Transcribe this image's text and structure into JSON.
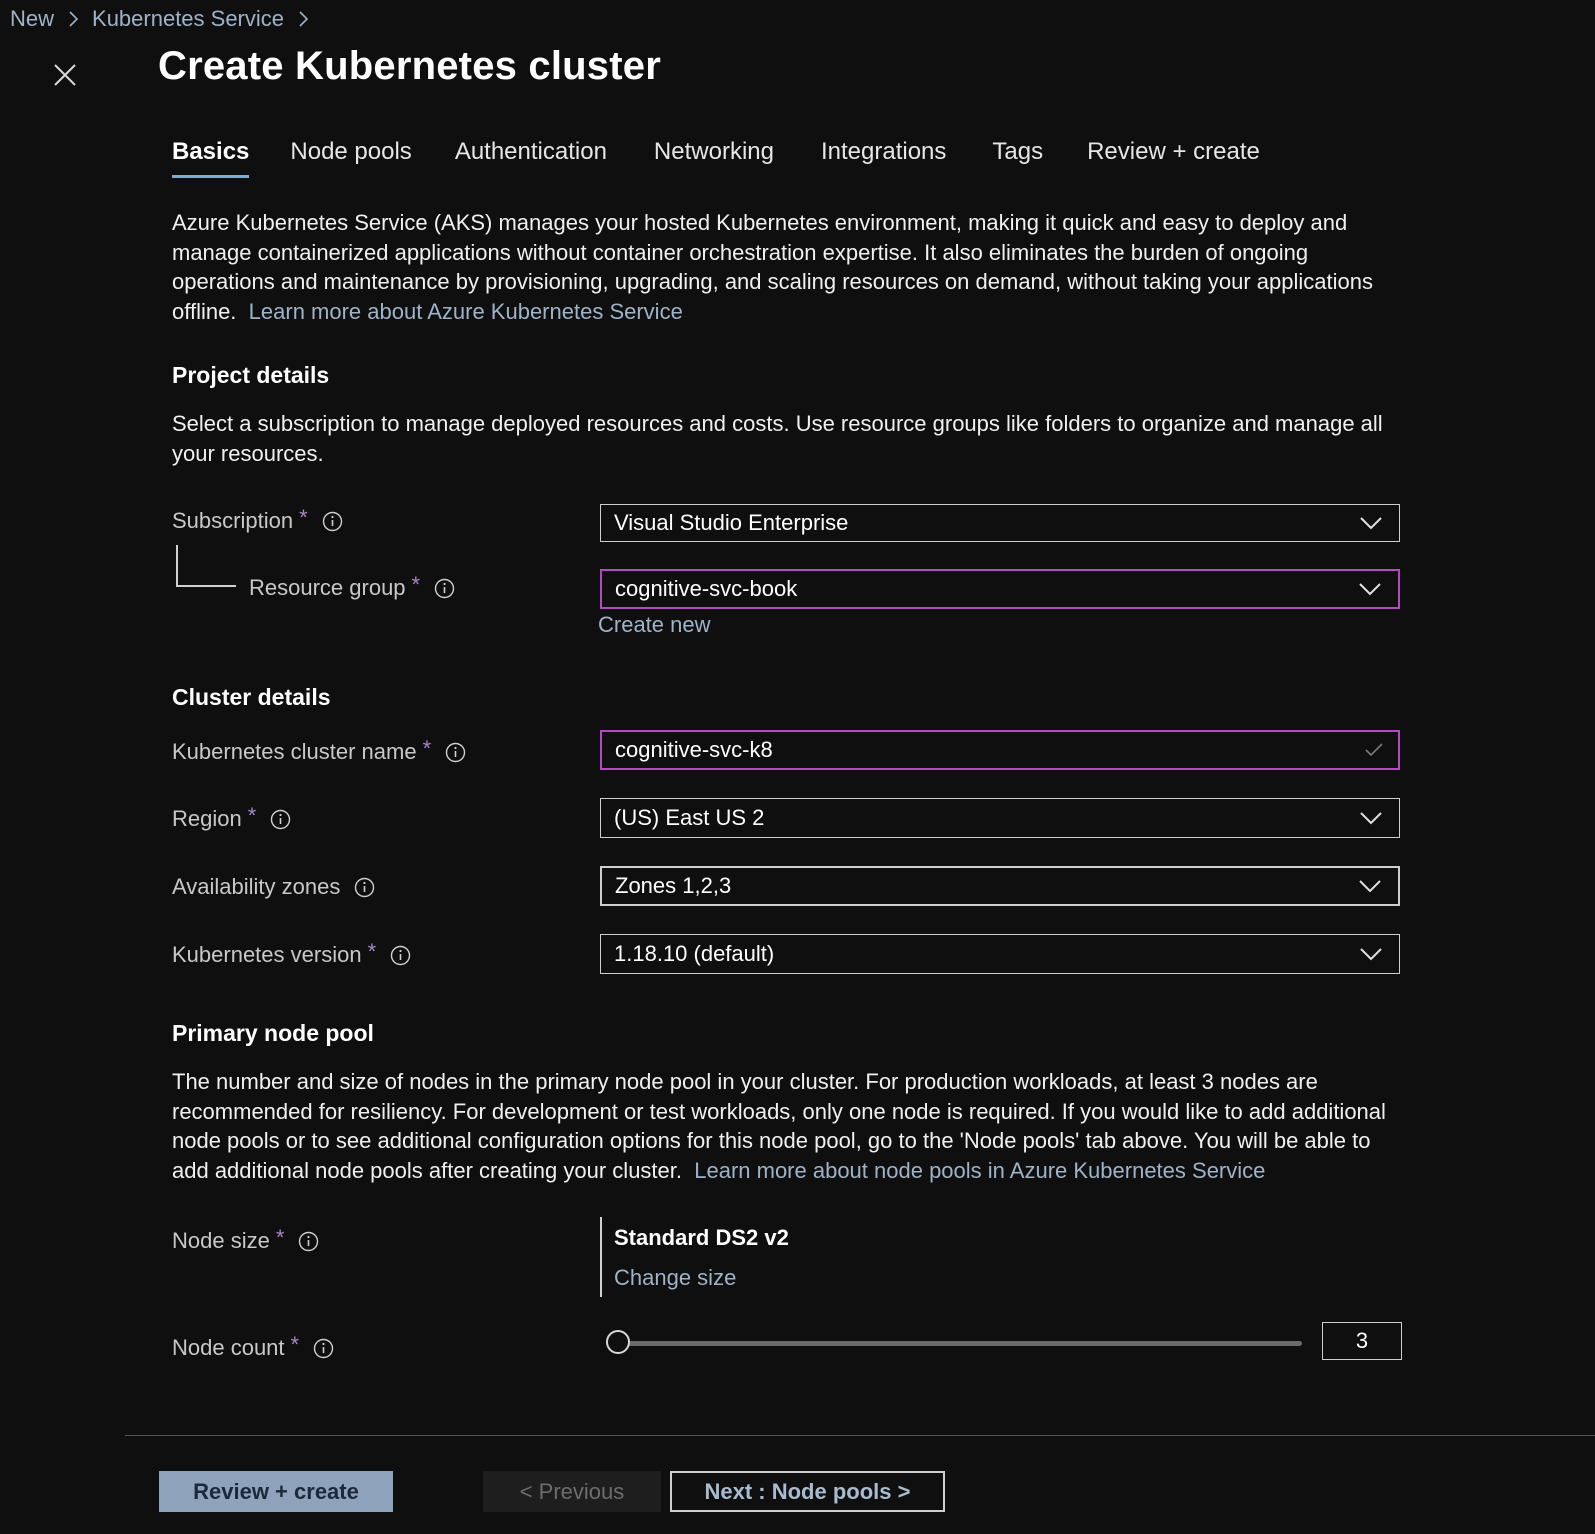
{
  "breadcrumb": {
    "items": [
      "New",
      "Kubernetes Service"
    ]
  },
  "page": {
    "title": "Create Kubernetes cluster"
  },
  "tabs": [
    {
      "label": "Basics",
      "active": true
    },
    {
      "label": "Node pools",
      "active": false
    },
    {
      "label": "Authentication",
      "active": false
    },
    {
      "label": "Networking",
      "active": false
    },
    {
      "label": "Integrations",
      "active": false
    },
    {
      "label": "Tags",
      "active": false
    },
    {
      "label": "Review + create",
      "active": false
    }
  ],
  "intro": {
    "text": "Azure Kubernetes Service (AKS) manages your hosted Kubernetes environment, making it quick and easy to deploy and manage containerized applications without container orchestration expertise. It also eliminates the burden of ongoing operations and maintenance by provisioning, upgrading, and scaling resources on demand, without taking your applications offline.",
    "link": "Learn more about Azure Kubernetes Service"
  },
  "project": {
    "title": "Project details",
    "description": "Select a subscription to manage deployed resources and costs. Use resource groups like folders to organize and manage all your resources.",
    "subscription": {
      "label": "Subscription",
      "required": "*",
      "value": "Visual Studio Enterprise"
    },
    "resource_group": {
      "label": "Resource group",
      "required": "*",
      "value": "cognitive-svc-book",
      "create_new": "Create new"
    }
  },
  "cluster": {
    "title": "Cluster details",
    "name": {
      "label": "Kubernetes cluster name",
      "required": "*",
      "value": "cognitive-svc-k8"
    },
    "region": {
      "label": "Region",
      "required": "*",
      "value": "(US) East US 2"
    },
    "zones": {
      "label": "Availability zones",
      "value": "Zones 1,2,3"
    },
    "version": {
      "label": "Kubernetes version",
      "required": "*",
      "value": "1.18.10 (default)"
    }
  },
  "node_pool": {
    "title": "Primary node pool",
    "description": "The number and size of nodes in the primary node pool in your cluster. For production workloads, at least 3 nodes are recommended for resiliency. For development or test workloads, only one node is required. If you would like to add additional node pools or to see additional configuration options for this node pool, go to the 'Node pools' tab above. You will be able to add additional node pools after creating your cluster.",
    "link": "Learn more about node pools in Azure Kubernetes Service",
    "node_size": {
      "label": "Node size",
      "required": "*",
      "value": "Standard DS2 v2",
      "change": "Change size"
    },
    "node_count": {
      "label": "Node count",
      "required": "*",
      "value": "3"
    }
  },
  "footer": {
    "review_create": "Review + create",
    "previous": "< Previous",
    "next": "Next : Node pools >"
  },
  "colors": {
    "background": "#0f0f0f",
    "link": "#9fb3c8",
    "focus_border": "#b14bbf",
    "required_star": "#a885c5",
    "primary_button": "#8fa2bb"
  },
  "icons": [
    "chevron-right-icon",
    "close-icon",
    "info-icon",
    "chevron-down-icon",
    "checkmark-icon"
  ]
}
